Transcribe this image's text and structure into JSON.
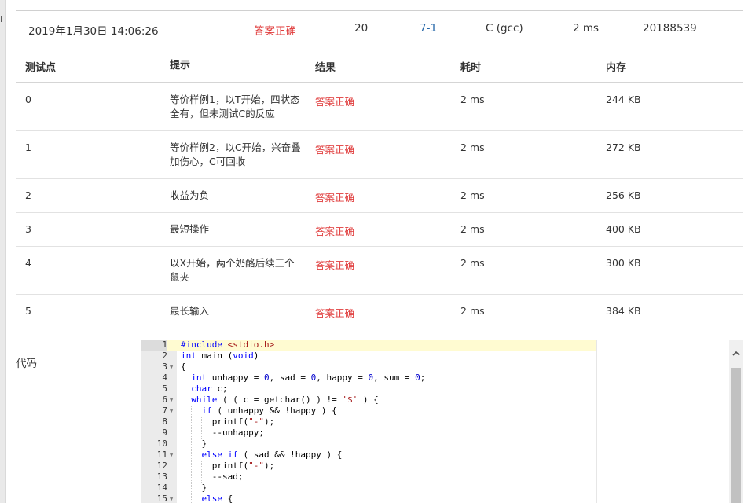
{
  "summary": {
    "time": "2019年1月30日 14:06:26",
    "status": "答案正确",
    "score": "20",
    "problem": "7-1",
    "language": "C (gcc)",
    "duration": "2 ms",
    "user": "20188539"
  },
  "results": {
    "headers": [
      "测试点",
      "提示",
      "结果",
      "耗时",
      "内存"
    ],
    "rows": [
      {
        "id": "0",
        "hint": "等价样例1，以T开始，四状态全有，但未测试C的反应",
        "result": "答案正确",
        "time": "2 ms",
        "memory": "244 KB"
      },
      {
        "id": "1",
        "hint": "等价样例2，以C开始，兴奋叠加伤心，C可回收",
        "result": "答案正确",
        "time": "2 ms",
        "memory": "272 KB"
      },
      {
        "id": "2",
        "hint": "收益为负",
        "result": "答案正确",
        "time": "2 ms",
        "memory": "256 KB"
      },
      {
        "id": "3",
        "hint": "最短操作",
        "result": "答案正确",
        "time": "2 ms",
        "memory": "400 KB"
      },
      {
        "id": "4",
        "hint": "以X开始，两个奶酪后续三个鼠夹",
        "result": "答案正确",
        "time": "2 ms",
        "memory": "300 KB"
      },
      {
        "id": "5",
        "hint": "最长输入",
        "result": "答案正确",
        "time": "2 ms",
        "memory": "384 KB"
      }
    ]
  },
  "code_section": {
    "label": "代码",
    "lines": [
      {
        "n": "1",
        "fold": false,
        "text": "#include <stdio.h>"
      },
      {
        "n": "2",
        "fold": false,
        "text": "int main (void)"
      },
      {
        "n": "3",
        "fold": true,
        "text": "{"
      },
      {
        "n": "4",
        "fold": false,
        "text": "  int unhappy = 0, sad = 0, happy = 0, sum = 0;"
      },
      {
        "n": "5",
        "fold": false,
        "text": "  char c;"
      },
      {
        "n": "6",
        "fold": true,
        "text": "  while ( ( c = getchar() ) != '$' ) {"
      },
      {
        "n": "7",
        "fold": true,
        "text": "    if ( unhappy && !happy ) {"
      },
      {
        "n": "8",
        "fold": false,
        "text": "      printf(\"-\");"
      },
      {
        "n": "9",
        "fold": false,
        "text": "      --unhappy;"
      },
      {
        "n": "10",
        "fold": false,
        "text": "    }"
      },
      {
        "n": "11",
        "fold": true,
        "text": "    else if ( sad && !happy ) {"
      },
      {
        "n": "12",
        "fold": false,
        "text": "      printf(\"-\");"
      },
      {
        "n": "13",
        "fold": false,
        "text": "      --sad;"
      },
      {
        "n": "14",
        "fold": false,
        "text": "    }"
      },
      {
        "n": "15",
        "fold": true,
        "text": "    else {"
      }
    ]
  },
  "icons": {
    "fold_marker": "fold-arrow-icon",
    "scroll_up": "chevron-up-icon"
  },
  "colors": {
    "accepted": "#e03c3c",
    "link": "#2466a8",
    "keyword": "#0000ff",
    "string": "#a31515",
    "number": "#0000cd"
  }
}
